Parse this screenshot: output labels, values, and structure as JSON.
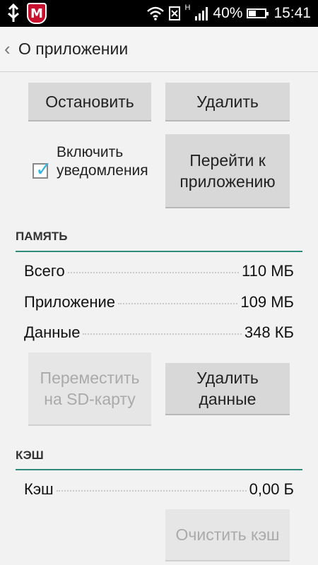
{
  "status_bar": {
    "network_type": "H",
    "battery_percent": "40%",
    "time": "15:41",
    "icons": [
      "usb-icon",
      "mcafee-icon",
      "wifi-icon",
      "sim-icon",
      "signal-icon",
      "battery-icon"
    ]
  },
  "action_bar": {
    "back_glyph": "‹",
    "title": "О приложении"
  },
  "buttons": {
    "stop": "Остановить",
    "uninstall": "Удалить",
    "open_app": "Перейти к приложению",
    "move_to_sd": "Переместить на SD-карту",
    "clear_data": "Удалить данные",
    "clear_cache": "Очистить кэш"
  },
  "notifications": {
    "label": "Включить уведомления",
    "checked": true
  },
  "memory": {
    "header": "ПАМЯТЬ",
    "rows": [
      {
        "label": "Всего",
        "value": "110 МБ"
      },
      {
        "label": "Приложение",
        "value": "109 МБ"
      },
      {
        "label": "Данные",
        "value": "348 КБ"
      }
    ]
  },
  "cache": {
    "header": "КЭШ",
    "rows": [
      {
        "label": "Кэш",
        "value": "0,00 Б"
      }
    ]
  },
  "colors": {
    "accent": "#33b5e5",
    "divider": "#2e8b7a",
    "mcafee_red": "#c8102e"
  }
}
